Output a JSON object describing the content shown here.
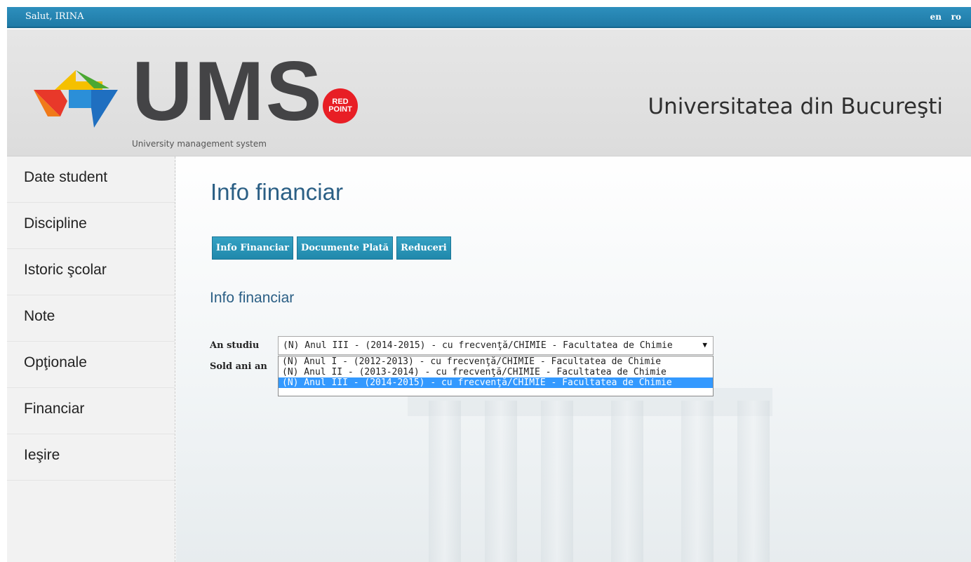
{
  "topbar": {
    "greeting": "Salut, IRINA",
    "lang_en": "en",
    "lang_ro": "ro"
  },
  "header": {
    "logo_text": "UMS",
    "logo_subtitle": "University management system",
    "badge_top": "RED",
    "badge_bottom": "POINT",
    "university": "Universitatea din Bucureşti"
  },
  "sidebar": {
    "items": [
      {
        "label": "Date student"
      },
      {
        "label": "Discipline"
      },
      {
        "label": "Istoric şcolar"
      },
      {
        "label": "Note"
      },
      {
        "label": "Opţionale"
      },
      {
        "label": "Financiar"
      },
      {
        "label": "Ieşire"
      }
    ]
  },
  "main": {
    "title": "Info financiar",
    "tabs": [
      {
        "label": "Info Financiar"
      },
      {
        "label": "Documente Plată"
      },
      {
        "label": "Reduceri"
      }
    ],
    "section_title": "Info financiar",
    "an_studiu_label": "An studiu",
    "sold_label": "Sold ani an",
    "select_value": "(N) Anul III - (2014-2015) - cu frecvenţă/CHIMIE - Facultatea de Chimie",
    "options": [
      "(N) Anul I - (2012-2013) - cu frecvenţă/CHIMIE - Facultatea de Chimie",
      "(N) Anul II - (2013-2014) - cu frecvenţă/CHIMIE - Facultatea de Chimie",
      "(N) Anul III - (2014-2015) - cu frecvenţă/CHIMIE - Facultatea de Chimie"
    ],
    "selected_index": 2
  },
  "colors": {
    "topbar": "#1f7aa6",
    "button": "#2088ab",
    "title": "#2b5f85",
    "selected": "#3399ff"
  },
  "icons": {
    "dropdown": "caret-down-icon",
    "logo": "ums-arrows-logo"
  }
}
